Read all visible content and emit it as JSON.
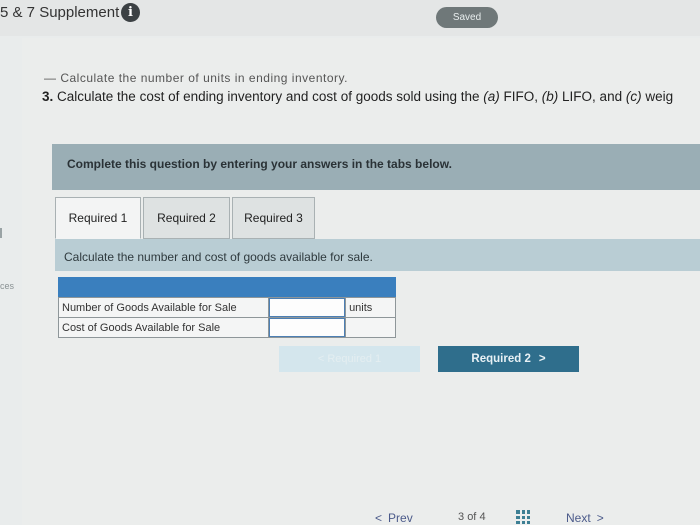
{
  "header": {
    "title": "5 & 7 Supplement",
    "info_icon": "info-icon",
    "saved_label": "Saved"
  },
  "question": {
    "cut_line": "— Calculate the number of units in ending inventory.",
    "number": "3.",
    "text_before": " Calculate the cost of ending inventory and cost of goods sold using the ",
    "a_label": "(a)",
    "a_text": " FIFO, ",
    "b_label": "(b)",
    "b_text": " LIFO, and ",
    "c_label": "(c)",
    "c_text": " weig"
  },
  "instruction": "Complete this question by entering your answers in the tabs below.",
  "tabs": [
    {
      "label": "Required 1",
      "active": true
    },
    {
      "label": "Required 2",
      "active": false
    },
    {
      "label": "Required 3",
      "active": false
    }
  ],
  "tab_instruction": "Calculate the number and cost of goods available for sale.",
  "side_label": "ces",
  "table": {
    "rows": [
      {
        "label": "Number of Goods Available for Sale",
        "value": "",
        "unit": "units"
      },
      {
        "label": "Cost of Goods Available for Sale",
        "value": "",
        "unit": ""
      }
    ]
  },
  "buttons": {
    "prev_required": "< Required 1",
    "next_required": "Required 2",
    "next_chevron": ">"
  },
  "footer": {
    "prev_chevron": "<",
    "prev_label": "Prev",
    "page_current": "3",
    "page_of": "of",
    "page_total": "4",
    "next_label": "Next",
    "next_chevron": ">"
  },
  "colors": {
    "banner": "#9aaeb5",
    "tab_panel": "#b9cdd4",
    "table_header": "#3a7fbe",
    "next_button": "#2f6e8c",
    "saved_badge": "#6f7879"
  }
}
